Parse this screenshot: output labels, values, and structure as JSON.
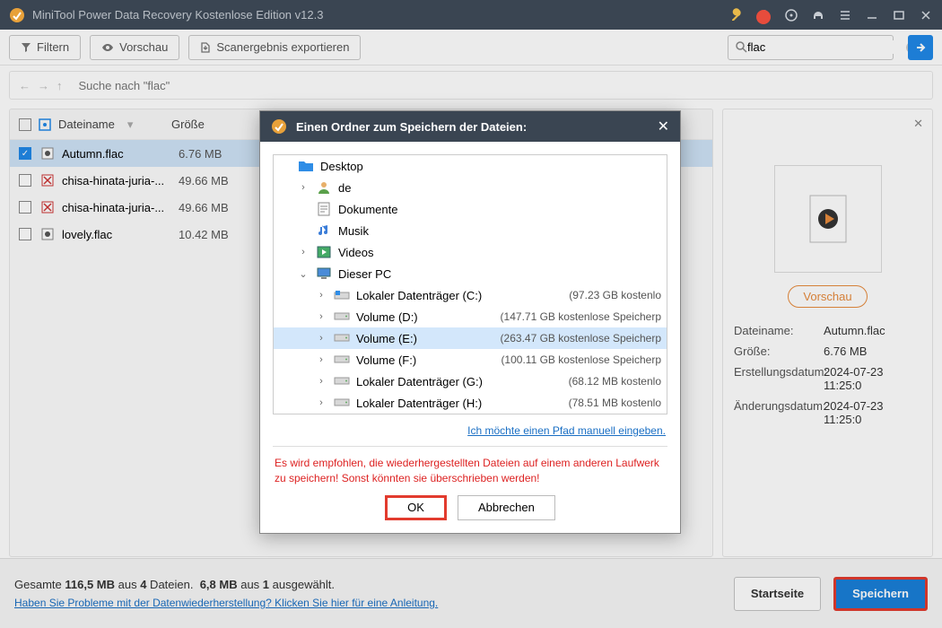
{
  "window": {
    "title": "MiniTool Power Data Recovery Kostenlose Edition v12.3"
  },
  "toolbar": {
    "filter": "Filtern",
    "preview": "Vorschau",
    "export": "Scanergebnis exportieren"
  },
  "search": {
    "value": "flac"
  },
  "breadcrumb": {
    "text": "Suche nach \"flac\""
  },
  "columns": {
    "name": "Dateiname",
    "size": "Größe"
  },
  "files": [
    {
      "name": "Autumn.flac",
      "size": "6.76 MB",
      "selected": true,
      "type": "audio"
    },
    {
      "name": "chisa-hinata-juria-...",
      "size": "49.66 MB",
      "selected": false,
      "type": "bad"
    },
    {
      "name": "chisa-hinata-juria-...",
      "size": "49.66 MB",
      "selected": false,
      "type": "bad"
    },
    {
      "name": "lovely.flac",
      "size": "10.42 MB",
      "selected": false,
      "type": "audio"
    }
  ],
  "preview": {
    "button": "Vorschau",
    "meta": {
      "filename_k": "Dateiname:",
      "filename_v": "Autumn.flac",
      "size_k": "Größe:",
      "size_v": "6.76 MB",
      "created_k": "Erstellungsdatum:",
      "created_v": "2024-07-23 11:25:0",
      "modified_k": "Änderungsdatum:",
      "modified_v": "2024-07-23 11:25:0"
    }
  },
  "footer": {
    "total": "Gesamte 116,5 MB aus 4 Dateien.  6,8 MB aus 1 ausgewählt.",
    "help": "Haben Sie Probleme mit der Datenwiederherstellung? Klicken Sie hier für eine Anleitung.",
    "home": "Startseite",
    "save": "Speichern"
  },
  "dialog": {
    "title": "Einen Ordner zum Speichern der Dateien:",
    "tree": [
      {
        "depth": 1,
        "expand": "",
        "icon": "folder-blue",
        "label": "Desktop",
        "free": ""
      },
      {
        "depth": 2,
        "expand": "›",
        "icon": "user",
        "label": "de",
        "free": ""
      },
      {
        "depth": 2,
        "expand": "",
        "icon": "doc",
        "label": "Dokumente",
        "free": ""
      },
      {
        "depth": 2,
        "expand": "",
        "icon": "music",
        "label": "Musik",
        "free": ""
      },
      {
        "depth": 2,
        "expand": "›",
        "icon": "video",
        "label": "Videos",
        "free": ""
      },
      {
        "depth": 2,
        "expand": "⌄",
        "icon": "pc",
        "label": "Dieser PC",
        "free": ""
      },
      {
        "depth": 3,
        "expand": "›",
        "icon": "drive-sys",
        "label": "Lokaler Datenträger (C:)",
        "free": "(97.23 GB kostenlo"
      },
      {
        "depth": 3,
        "expand": "›",
        "icon": "drive",
        "label": "Volume (D:)",
        "free": "(147.71 GB kostenlose Speicherp"
      },
      {
        "depth": 3,
        "expand": "›",
        "icon": "drive",
        "label": "Volume (E:)",
        "free": "(263.47 GB kostenlose Speicherp",
        "selected": true
      },
      {
        "depth": 3,
        "expand": "›",
        "icon": "drive",
        "label": "Volume (F:)",
        "free": "(100.11 GB kostenlose Speicherp"
      },
      {
        "depth": 3,
        "expand": "›",
        "icon": "drive",
        "label": "Lokaler Datenträger (G:)",
        "free": "(68.12 MB kostenlo"
      },
      {
        "depth": 3,
        "expand": "›",
        "icon": "drive",
        "label": "Lokaler Datenträger (H:)",
        "free": "(78.51 MB kostenlo"
      }
    ],
    "manual": "Ich möchte einen Pfad manuell eingeben.",
    "warning": "Es wird empfohlen, die wiederhergestellten Dateien auf einem anderen Laufwerk zu speichern! Sonst könnten sie überschrieben werden!",
    "ok": "OK",
    "cancel": "Abbrechen"
  }
}
